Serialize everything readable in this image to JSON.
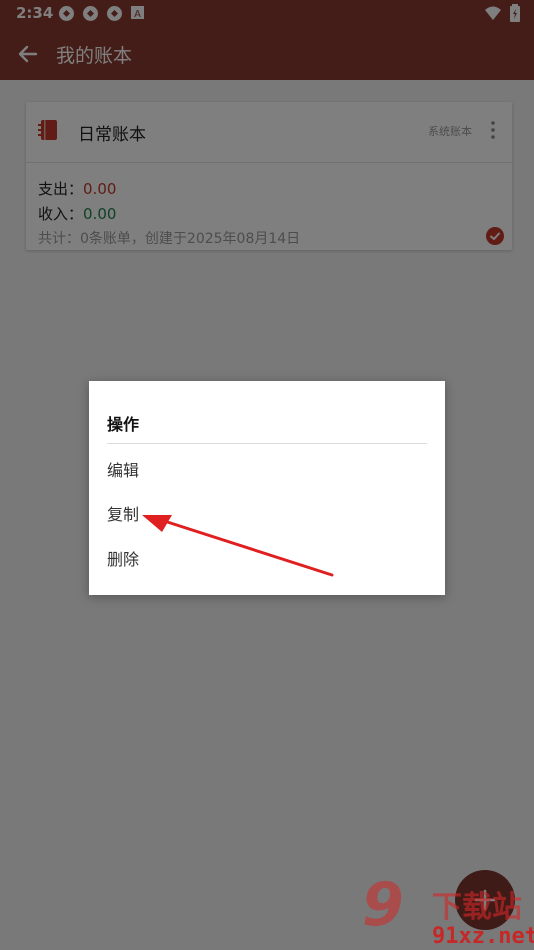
{
  "status": {
    "time": "2:34"
  },
  "appbar": {
    "title": "我的账本"
  },
  "ledger": {
    "name": "日常账本",
    "tag": "系统账本",
    "expense_label": "支出：",
    "expense_value": "0.00",
    "income_label": "收入：",
    "income_value": "0.00",
    "summary": "共计：0条账单，创建于2025年08月14日"
  },
  "dialog": {
    "title": "操作",
    "items": [
      "编辑",
      "复制",
      "删除"
    ]
  },
  "watermark": {
    "cn": "下载站",
    "en": "91xz.net",
    "logo": "9"
  },
  "colors": {
    "primary": "#8b3a31",
    "expense": "#c0392b",
    "income": "#1e8449",
    "annotation_arrow": "#e02020"
  }
}
